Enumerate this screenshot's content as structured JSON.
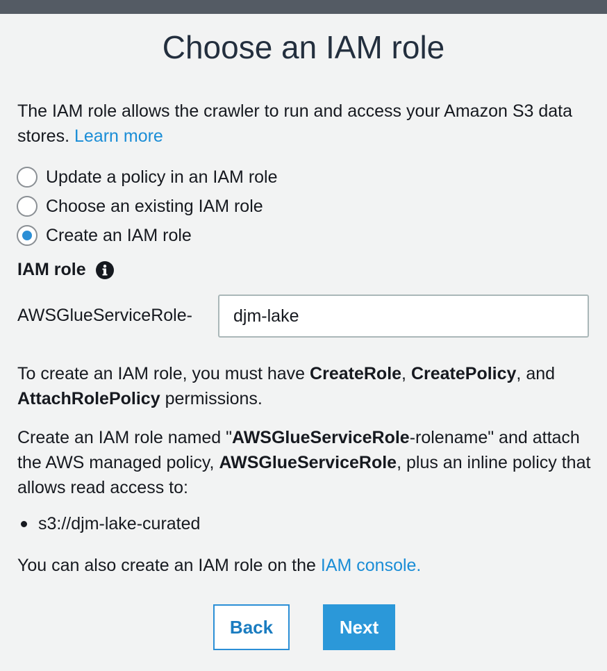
{
  "dialog": {
    "title": "Choose an IAM role",
    "intro_text": "The IAM role allows the crawler to run and access your Amazon S3 data stores.",
    "learn_more_link": "Learn more"
  },
  "options": [
    {
      "label": "Update a policy in an IAM role",
      "selected": false
    },
    {
      "label": "Choose an existing IAM role",
      "selected": false
    },
    {
      "label": "Create an IAM role",
      "selected": true
    }
  ],
  "iam_role": {
    "label": "IAM role",
    "prefix": "AWSGlueServiceRole-",
    "value": "djm-lake"
  },
  "permissions": {
    "intro": "To create an IAM role, you must have",
    "perm1": "CreateRole",
    "sep1": ",",
    "perm2": "CreatePolicy",
    "sep2": ",",
    "and_text": "and",
    "perm3": "AttachRolePolicy",
    "suffix": "permissions."
  },
  "description": {
    "part1": "Create an IAM role named \"",
    "bold1": "AWSGlueServiceRole",
    "part2": "-rolename\" and attach the AWS managed policy,",
    "bold2": "AWSGlueServiceRole",
    "part3": ", plus an inline policy that allows read access to:"
  },
  "s3_paths": [
    "s3://djm-lake-curated"
  ],
  "console_note": {
    "text": "You can also create an IAM role on the",
    "link": "IAM console."
  },
  "buttons": {
    "back": "Back",
    "next": "Next"
  },
  "colors": {
    "accent": "#2b98d9",
    "link": "#1a8dd6",
    "background": "#f2f3f3"
  }
}
